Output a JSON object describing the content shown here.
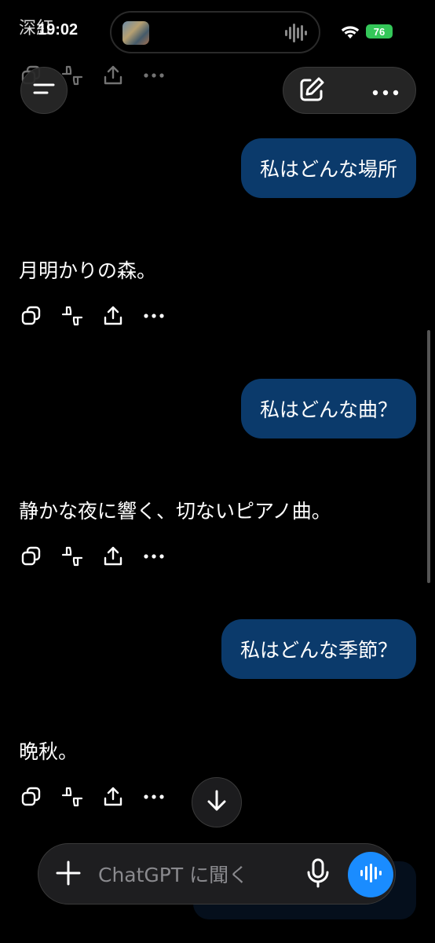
{
  "top_residual_text": "深紅",
  "status_bar": {
    "time": "19:02",
    "battery": "76"
  },
  "messages": [
    {
      "role": "user",
      "text": "私はどんな場所"
    },
    {
      "role": "assistant",
      "text": "月明かりの森。"
    },
    {
      "role": "user",
      "text": "私はどんな曲？"
    },
    {
      "role": "assistant",
      "text": "静かな夜に響く、切ないピアノ曲。"
    },
    {
      "role": "user",
      "text": "私はどんな季節？"
    },
    {
      "role": "assistant",
      "text": "晩秋。"
    }
  ],
  "composer": {
    "placeholder": "ChatGPT に聞く"
  },
  "icons": {
    "menu": "menu-icon",
    "compose": "compose-icon",
    "more": "more-icon",
    "copy": "copy-icon",
    "feedback": "thumbs-icon",
    "share": "share-icon",
    "scroll_down": "arrow-down-icon",
    "plus": "plus-icon",
    "mic": "microphone-icon",
    "voice": "voice-waveform-icon"
  },
  "colors": {
    "background": "#000000",
    "user_bubble": "#0b3a6b",
    "voice_button": "#1a8cff",
    "battery": "#34c759"
  }
}
